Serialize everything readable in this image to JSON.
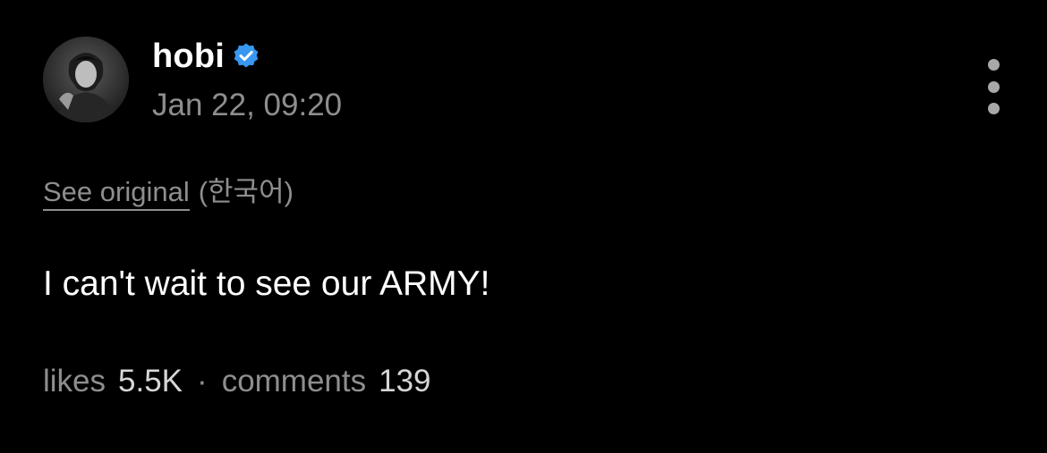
{
  "post": {
    "author": {
      "username": "hobi",
      "verified": true,
      "avatar_icon": "profile-photo"
    },
    "timestamp": "Jan 22, 09:20",
    "translation": {
      "see_original_label": "See original",
      "language": "(한국어)"
    },
    "text": "I can't wait to see our ARMY!",
    "stats": {
      "likes_label": "likes",
      "likes_value": "5.5K",
      "separator": "·",
      "comments_label": "comments",
      "comments_value": "139"
    },
    "menu_icon": "more-vertical-icon"
  },
  "colors": {
    "background": "#000000",
    "primary_text": "#ffffff",
    "secondary_text": "#8e8e8e",
    "verified_badge": "#3897f0"
  }
}
